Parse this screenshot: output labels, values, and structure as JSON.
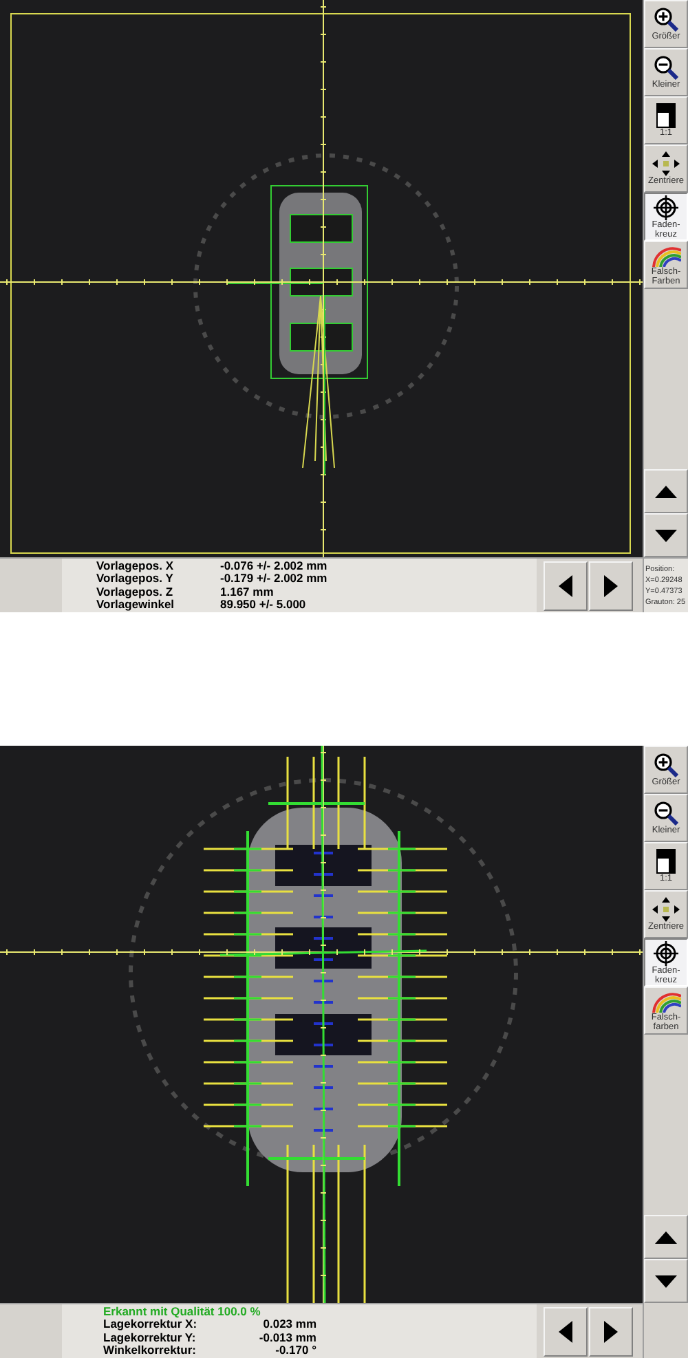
{
  "panels": [
    {
      "kind": "position",
      "toolbar": [
        {
          "label": "Größer",
          "kind": "zoom-in",
          "selected": false
        },
        {
          "label": "Kleiner",
          "kind": "zoom-out",
          "selected": false
        },
        {
          "label": "1:1",
          "kind": "actual",
          "selected": false
        },
        {
          "label": "Zentriere",
          "kind": "center",
          "selected": false
        },
        {
          "label": "Faden-kreuz",
          "kind": "crosshair",
          "selected": true
        },
        {
          "label": "Falsch-Farben",
          "kind": "rainbow",
          "selected": false
        }
      ],
      "info": {
        "rows": [
          {
            "label": "Vorlagepos. X",
            "value": "-0.076 +/- 2.002 mm"
          },
          {
            "label": "Vorlagepos. Y",
            "value": "-0.179 +/- 2.002 mm"
          },
          {
            "label": "Vorlagepos. Z",
            "value": "1.167 mm"
          },
          {
            "label": "Vorlagewinkel",
            "value": "89.950 +/- 5.000"
          }
        ]
      },
      "position": [
        "Position:",
        "X=0.29248",
        "Y=0.47373",
        "Grauton: 25"
      ]
    },
    {
      "kind": "recognized",
      "toolbar": [
        {
          "label": "Größer",
          "kind": "zoom-in",
          "selected": false
        },
        {
          "label": "Kleiner",
          "kind": "zoom-out",
          "selected": false
        },
        {
          "label": "1:1",
          "kind": "actual",
          "selected": false
        },
        {
          "label": "Zentriere",
          "kind": "center",
          "selected": false
        },
        {
          "label": "Faden-kreuz",
          "kind": "crosshair",
          "selected": true
        },
        {
          "label": "Falsch-farben",
          "kind": "rainbow",
          "selected": false
        }
      ],
      "info": {
        "headline": "Erkannt mit Qualität 100.0 %",
        "rows": [
          {
            "label": "Lagekorrektur X:",
            "value": "0.023 mm"
          },
          {
            "label": "Lagekorrektur Y:",
            "value": "-0.013 mm"
          },
          {
            "label": "Winkelkorrektur:",
            "value": "-0.170 °"
          }
        ]
      }
    }
  ]
}
